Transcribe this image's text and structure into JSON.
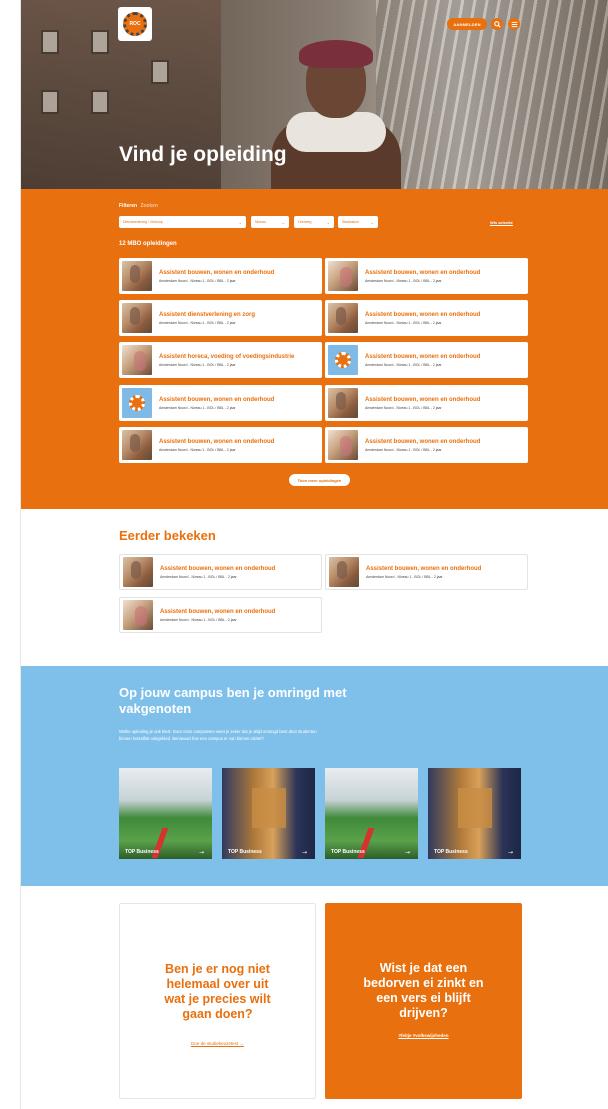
{
  "header": {
    "logo_text": "ROC",
    "register_label": "AANMELDEN",
    "search_icon": "search-icon",
    "menu_icon": "menu-icon",
    "title": "Vind je opleiding"
  },
  "filters": {
    "label": "Filteren",
    "search_label": "Zoeken",
    "selects": [
      "Dienstverlening / Verkoop",
      "Niveau",
      "Leerweg",
      "Startdatum"
    ],
    "clear_label": "Wis selectie",
    "count_label": "12 MBO opleidingen"
  },
  "programs": [
    {
      "title": "Assistent bouwen, wonen en onderhoud",
      "meta": "Amsterdam Noord - Niveau 1 - BOL / BBL - 2 jaar",
      "thumb": "photo"
    },
    {
      "title": "Assistent bouwen, wonen en onderhoud",
      "meta": "Amsterdam Noord - Niveau 1 - BOL / BBL - 2 jaar",
      "thumb": "photo2"
    },
    {
      "title": "Assistent dienstverlening en zorg",
      "meta": "Amsterdam Noord - Niveau 1 - BOL / BBL - 2 jaar",
      "thumb": "photo"
    },
    {
      "title": "Assistent bouwen, wonen en onderhoud",
      "meta": "Amsterdam Noord - Niveau 1 - BOL / BBL - 2 jaar",
      "thumb": "photo"
    },
    {
      "title": "Assistent horeca, voeding of voedingsindustrie",
      "meta": "Amsterdam Noord - Niveau 1 - BOL / BBL - 2 jaar",
      "thumb": "photo2"
    },
    {
      "title": "Assistent bouwen, wonen en onderhoud",
      "meta": "Amsterdam Noord - Niveau 1 - BOL / BBL - 2 jaar",
      "thumb": "logo"
    },
    {
      "title": "Assistent bouwen, wonen en onderhoud",
      "meta": "Amsterdam Noord - Niveau 1 - BOL / BBL - 2 jaar",
      "thumb": "logo"
    },
    {
      "title": "Assistent bouwen, wonen en onderhoud",
      "meta": "Amsterdam Noord - Niveau 1 - BOL / BBL - 2 jaar",
      "thumb": "photo"
    },
    {
      "title": "Assistent bouwen, wonen en onderhoud",
      "meta": "Amsterdam Noord - Niveau 1 - BOL / BBL - 2 jaar",
      "thumb": "photo"
    },
    {
      "title": "Assistent bouwen, wonen en onderhoud",
      "meta": "Amsterdam Noord - Niveau 1 - BOL / BBL - 2 jaar",
      "thumb": "photo2"
    }
  ],
  "more_label": "Toon meer opleidingen",
  "recent": {
    "title": "Eerder bekeken",
    "items": [
      {
        "title": "Assistent bouwen, wonen en onderhoud",
        "meta": "Amsterdam Noord - Niveau 1 - BOL / BBL - 2 jaar",
        "thumb": "photo"
      },
      {
        "title": "Assistent bouwen, wonen en onderhoud",
        "meta": "Amsterdam Noord - Niveau 1 - BOL / BBL - 2 jaar",
        "thumb": "photo"
      },
      {
        "title": "Assistent bouwen, wonen en onderhoud",
        "meta": "Amsterdam Noord - Niveau 1 - BOL / BBL - 2 jaar",
        "thumb": "photo2"
      }
    ]
  },
  "campus": {
    "title": "Op jouw campus ben je omringd met vakgenoten",
    "text": "Welke opleiding je ook kiest. Door onze campussen weet je zeker dat je altijd omringd bent door studenten binnen hetzelfde vakgebied. Benieuwd hoe een campus er van binnen uitziet?",
    "tiles": [
      {
        "label": "TOP Business",
        "style": "c1"
      },
      {
        "label": "TOP Business",
        "style": "c2"
      },
      {
        "label": "TOP Business",
        "style": "c1"
      },
      {
        "label": "TOP Business",
        "style": "c2"
      }
    ]
  },
  "cta_white": {
    "title": "Ben je er nog niet helemaal over uit wat je precies wilt gaan doen?",
    "link": "Doe de studiekeuzetest →"
  },
  "cta_orange": {
    "title": "Wist je dat een bedorven ei zinkt en een vers ei blijft drijven?",
    "link": "#feitje #volkswijsheden"
  },
  "colors": {
    "brand_orange": "#e8700e",
    "campus_blue": "#7fc0ea"
  }
}
